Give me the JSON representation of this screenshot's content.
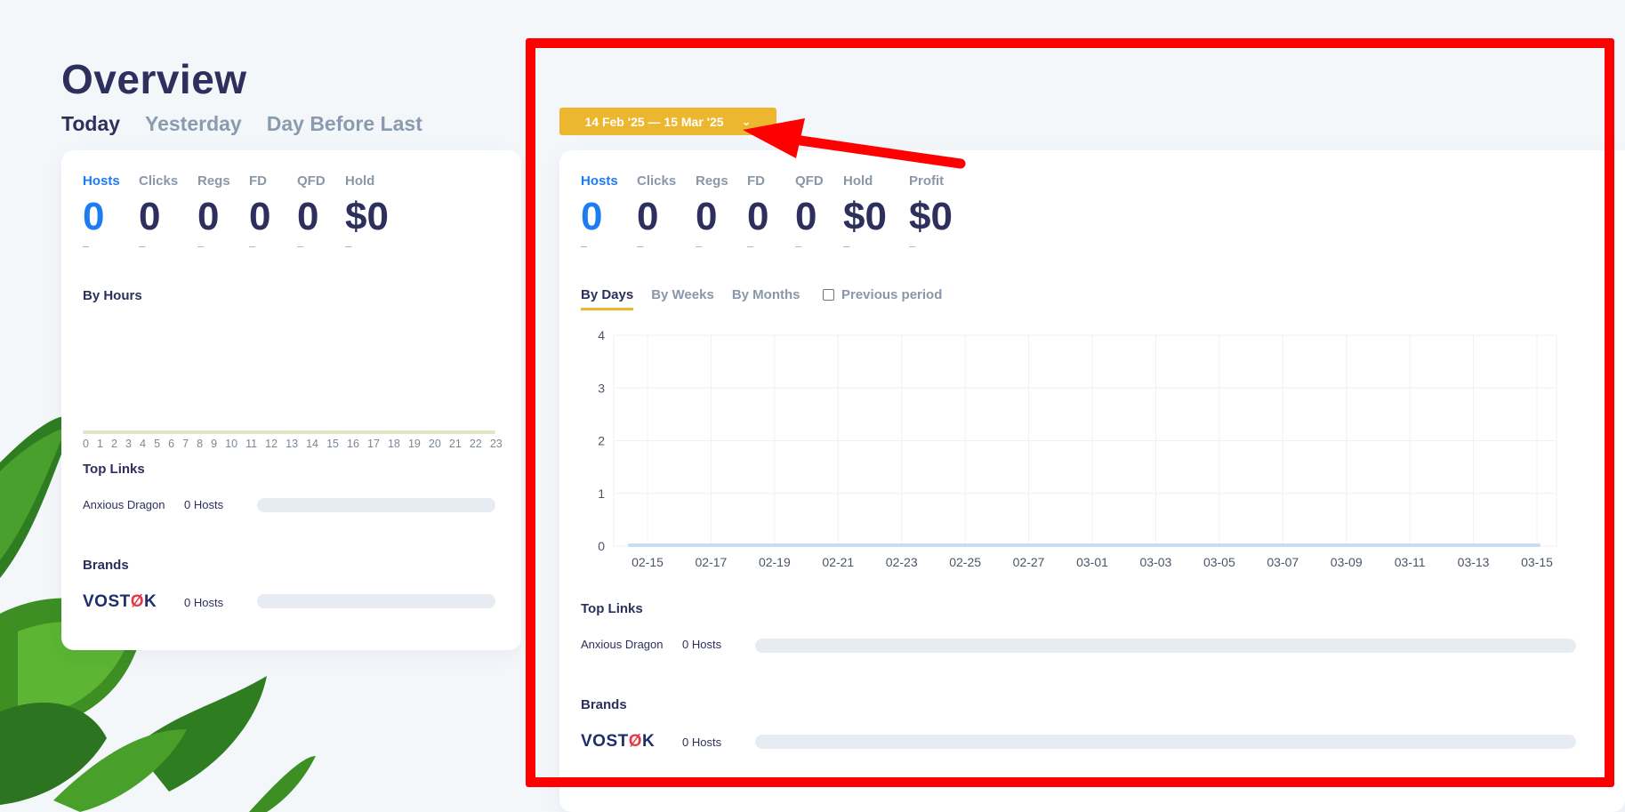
{
  "overview": {
    "title": "Overview",
    "day_tabs": [
      {
        "label": "Today",
        "active": true
      },
      {
        "label": "Yesterday",
        "active": false
      },
      {
        "label": "Day Before Last",
        "active": false
      }
    ]
  },
  "left_card": {
    "metrics": [
      {
        "label": "Hosts",
        "value": "0",
        "change": "–"
      },
      {
        "label": "Clicks",
        "value": "0",
        "change": "–"
      },
      {
        "label": "Regs",
        "value": "0",
        "change": "–"
      },
      {
        "label": "FD",
        "value": "0",
        "change": "–"
      },
      {
        "label": "QFD",
        "value": "0",
        "change": "–"
      },
      {
        "label": "Hold",
        "value": "$0",
        "change": "–"
      }
    ],
    "by_hours_title": "By Hours",
    "hours": [
      "0",
      "1",
      "2",
      "3",
      "4",
      "5",
      "6",
      "7",
      "8",
      "9",
      "10",
      "11",
      "12",
      "13",
      "14",
      "15",
      "16",
      "17",
      "18",
      "19",
      "20",
      "21",
      "22",
      "23"
    ],
    "top_links_title": "Top Links",
    "top_links": [
      {
        "name": "Anxious Dragon",
        "hosts": "0 Hosts",
        "fill": 0
      }
    ],
    "brands_title": "Brands",
    "brands": [
      {
        "name_prefix": "VOST",
        "name_mark": "Ø",
        "name_suffix": "K",
        "hosts": "0 Hosts",
        "fill": 0
      }
    ]
  },
  "right_card": {
    "date_range": "14 Feb '25 — 15 Mar '25",
    "metrics": [
      {
        "label": "Hosts",
        "value": "0",
        "change": "–"
      },
      {
        "label": "Clicks",
        "value": "0",
        "change": "–"
      },
      {
        "label": "Regs",
        "value": "0",
        "change": "–"
      },
      {
        "label": "FD",
        "value": "0",
        "change": "–"
      },
      {
        "label": "QFD",
        "value": "0",
        "change": "–"
      },
      {
        "label": "Hold",
        "value": "$0",
        "change": "–"
      },
      {
        "label": "Profit",
        "value": "$0",
        "change": "–"
      }
    ],
    "period_tabs": [
      {
        "label": "By Days",
        "active": true
      },
      {
        "label": "By Weeks",
        "active": false
      },
      {
        "label": "By Months",
        "active": false
      }
    ],
    "previous_period_label": "Previous period",
    "previous_period_checked": false,
    "top_links_title": "Top Links",
    "top_links": [
      {
        "name": "Anxious Dragon",
        "hosts": "0 Hosts",
        "fill": 0
      }
    ],
    "brands_title": "Brands",
    "brands": [
      {
        "name_prefix": "VOST",
        "name_mark": "Ø",
        "name_suffix": "K",
        "hosts": "0 Hosts",
        "fill": 0
      }
    ]
  },
  "chart_data": {
    "type": "line",
    "x": [
      "02-15",
      "02-17",
      "02-19",
      "02-21",
      "02-23",
      "02-25",
      "02-27",
      "03-01",
      "03-03",
      "03-05",
      "03-07",
      "03-09",
      "03-11",
      "03-13",
      "03-15"
    ],
    "series": [
      {
        "values": [
          0,
          0,
          0,
          0,
          0,
          0,
          0,
          0,
          0,
          0,
          0,
          0,
          0,
          0,
          0
        ]
      }
    ],
    "yticks": [
      0,
      1,
      2,
      3,
      4
    ],
    "ylim": [
      0,
      4
    ],
    "grid": true,
    "line_color": "#c9dcf5"
  },
  "colors": {
    "accent_blue": "#1e7cf2",
    "date_button": "#ecb62e",
    "highlight_red": "#ff0000",
    "title_navy": "#2d2f5c"
  }
}
